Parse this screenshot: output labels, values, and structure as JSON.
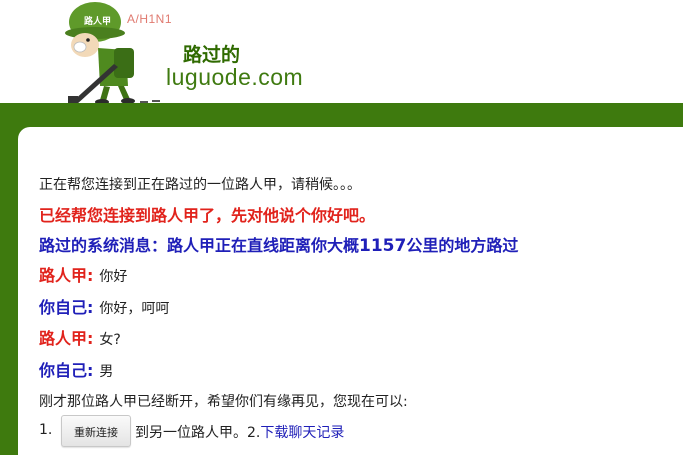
{
  "header": {
    "badge_text": "A/H1N1",
    "site_name_cn": "路过的",
    "site_url": "luguode.com",
    "mascot_label": "路人甲"
  },
  "chat": {
    "connecting": "正在帮您连接到正在路过的一位路人甲，请稍候。。。",
    "connected": "已经帮您连接到路人甲了，先对他说个你好吧。",
    "system_prefix": "路过的系统消息：路人甲正在直线距离你大概",
    "system_distance": "1157",
    "system_suffix": "公里的地方路过",
    "messages": [
      {
        "who": "路人甲:",
        "text": "你好"
      },
      {
        "who": "你自己:",
        "text": "你好，呵呵"
      },
      {
        "who": "路人甲:",
        "text": "女?"
      },
      {
        "who": "你自己:",
        "text": "男"
      }
    ],
    "disconnected": "刚才那位路人甲已经断开，希望你们有缘再见，您现在可以:"
  },
  "actions": {
    "step1_num": "1.",
    "reconnect_button": "重新连接",
    "step1_text": "到另一位路人甲。2.",
    "download_link": "下载聊天记录"
  },
  "colors": {
    "green": "#3e7a0e",
    "red": "#e1231c",
    "blue": "#1f1fb8"
  }
}
